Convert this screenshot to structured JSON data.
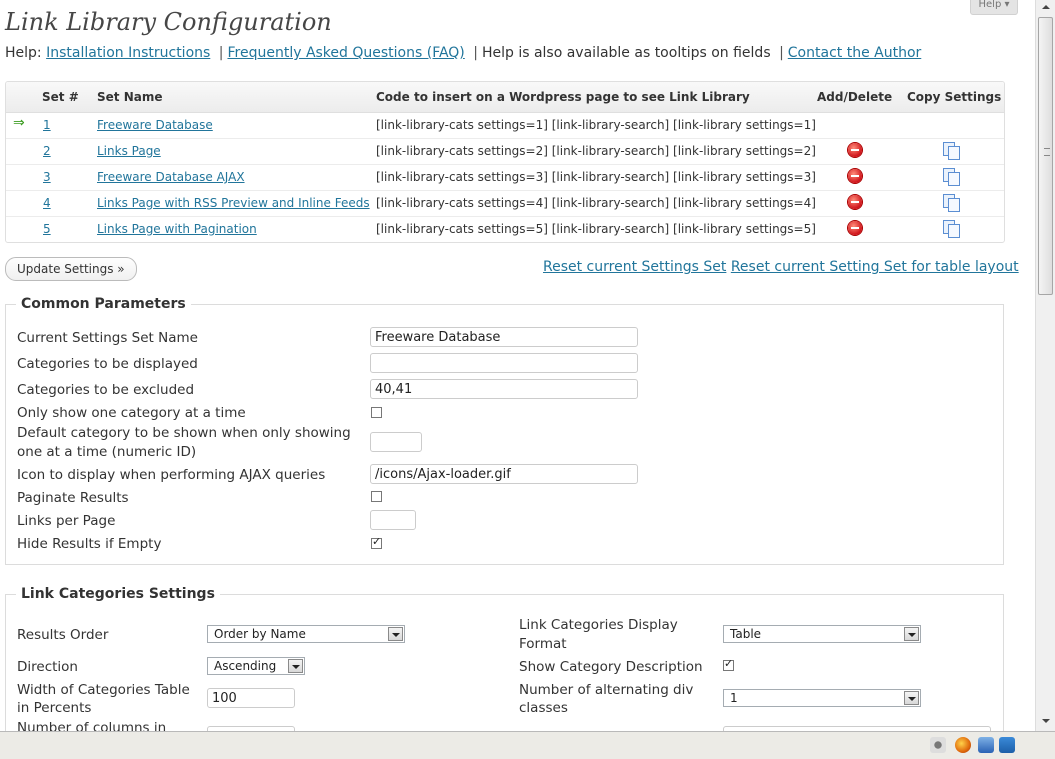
{
  "page": {
    "title": "Link Library Configuration",
    "help_tab": "Help ▾"
  },
  "helpline": {
    "prefix": "Help:",
    "install_link": "Installation Instructions",
    "faq_link": "Frequently Asked Questions (FAQ)",
    "tooltip_text": "Help is also available as tooltips on fields",
    "contact_link": "Contact the Author",
    "separator": "|"
  },
  "sets_table": {
    "headers": {
      "num": "Set #",
      "name": "Set Name",
      "code": "Code to insert on a Wordpress page to see Link Library",
      "add_delete": "Add/Delete",
      "copy": "Copy Settings"
    },
    "current_marker": "⇒",
    "rows": [
      {
        "num": "1",
        "name": "Freeware Database",
        "code": "[link-library-cats settings=1] [link-library-search] [link-library settings=1]",
        "current": true
      },
      {
        "num": "2",
        "name": "Links Page",
        "code": "[link-library-cats settings=2] [link-library-search] [link-library settings=2]",
        "current": false
      },
      {
        "num": "3",
        "name": "Freeware Database AJAX",
        "code": "[link-library-cats settings=3] [link-library-search] [link-library settings=3]",
        "current": false
      },
      {
        "num": "4",
        "name": "Links Page with RSS Preview and Inline Feeds",
        "code": "[link-library-cats settings=4] [link-library-search] [link-library settings=4]",
        "current": false
      },
      {
        "num": "5",
        "name": "Links Page with Pagination",
        "code": "[link-library-cats settings=5] [link-library-search] [link-library settings=5]",
        "current": false
      }
    ]
  },
  "actions": {
    "update_button": "Update Settings »",
    "reset_link": "Reset current Settings Set",
    "reset_table_link": "Reset current Setting Set for table layout"
  },
  "common": {
    "legend": "Common Parameters",
    "set_name_label": "Current Settings Set Name",
    "set_name_value": "Freeware Database",
    "cats_displayed_label": "Categories to be displayed",
    "cats_displayed_value": "",
    "cats_excluded_label": "Categories to be excluded",
    "cats_excluded_value": "40,41",
    "one_cat_label": "Only show one category at a time",
    "one_cat_checked": false,
    "default_cat_label_1": "Default category to be shown when only showing",
    "default_cat_label_2": "one at a time (numeric ID)",
    "default_cat_value": "",
    "ajax_icon_label": "Icon to display when performing AJAX queries",
    "ajax_icon_value": "/icons/Ajax-loader.gif",
    "paginate_label": "Paginate Results",
    "paginate_checked": false,
    "links_per_page_label": "Links per Page",
    "links_per_page_value": "",
    "hide_empty_label": "Hide Results if Empty",
    "hide_empty_checked": true
  },
  "categories": {
    "legend": "Link Categories Settings",
    "results_order_label": "Results Order",
    "results_order_value": "Order by Name",
    "display_format_label_1": "Link Categories Display",
    "display_format_label_2": "Format",
    "display_format_value": "Table",
    "direction_label": "Direction",
    "direction_value": "Ascending",
    "show_desc_label": "Show Category Description",
    "show_desc_checked": true,
    "width_label_1": "Width of Categories Table",
    "width_label_2": "in Percents",
    "width_value": "100",
    "alt_div_label_1": "Number of alternating div",
    "alt_div_label_2": "classes",
    "alt_div_value": "1",
    "columns_label": "Number of columns in"
  },
  "colors": {
    "link": "#21759b",
    "arrow": "#3a9b1f",
    "delete": "#d0131a"
  }
}
